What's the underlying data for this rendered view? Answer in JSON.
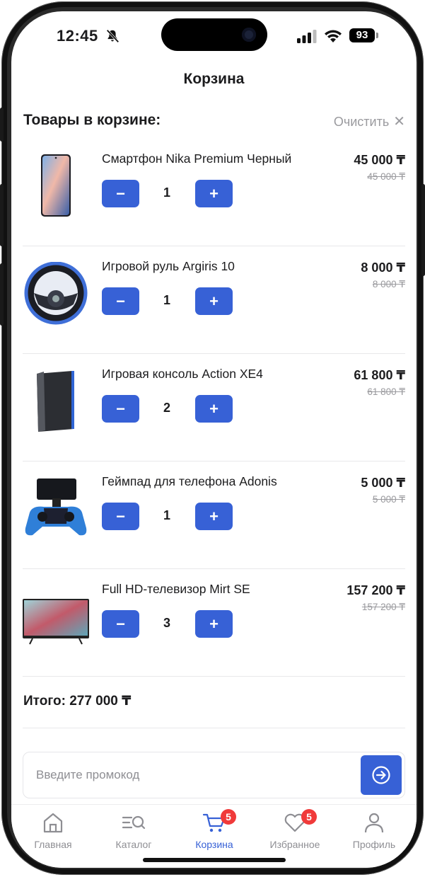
{
  "status_bar": {
    "time": "12:45",
    "battery": "93"
  },
  "header": {
    "title": "Корзина"
  },
  "cart": {
    "section_title": "Товары в корзине:",
    "clear_label": "Очистить",
    "clear_icon": "✕",
    "items": [
      {
        "name": "Смартфон Nika Premium Черный",
        "price": "45 000 ₸",
        "old_price": "45 000 ₸",
        "qty": "1",
        "icon": "smartphone"
      },
      {
        "name": "Игровой руль Argiris 10",
        "price": "8 000 ₸",
        "old_price": "8 000 ₸",
        "qty": "1",
        "icon": "steering-wheel"
      },
      {
        "name": "Игровая консоль Action XE4",
        "price": "61 800 ₸",
        "old_price": "61 800 ₸",
        "qty": "2",
        "icon": "game-console"
      },
      {
        "name": "Геймпад для телефона Adonis",
        "price": "5 000 ₸",
        "old_price": "5 000 ₸",
        "qty": "1",
        "icon": "gamepad"
      },
      {
        "name": "Full HD-телевизор Mirt SE",
        "price": "157 200 ₸",
        "old_price": "157 200 ₸",
        "qty": "3",
        "icon": "tv"
      }
    ],
    "minus_label": "−",
    "plus_label": "+",
    "total": "Итого: 277 000 ₸"
  },
  "promo": {
    "placeholder": "Введите промокод",
    "submit_icon": "arrow-right-circle"
  },
  "tabbar": {
    "tabs": [
      {
        "label": "Главная",
        "icon": "home",
        "active": false
      },
      {
        "label": "Каталог",
        "icon": "catalog-search",
        "active": false
      },
      {
        "label": "Корзина",
        "icon": "cart",
        "active": true,
        "badge": "5"
      },
      {
        "label": "Избранное",
        "icon": "heart",
        "active": false,
        "badge": "5"
      },
      {
        "label": "Профиль",
        "icon": "user",
        "active": false
      }
    ]
  },
  "colors": {
    "accent": "#3761d6",
    "badge": "#f03a3a",
    "muted": "#9a9a9e",
    "text": "#1c1c1e"
  }
}
